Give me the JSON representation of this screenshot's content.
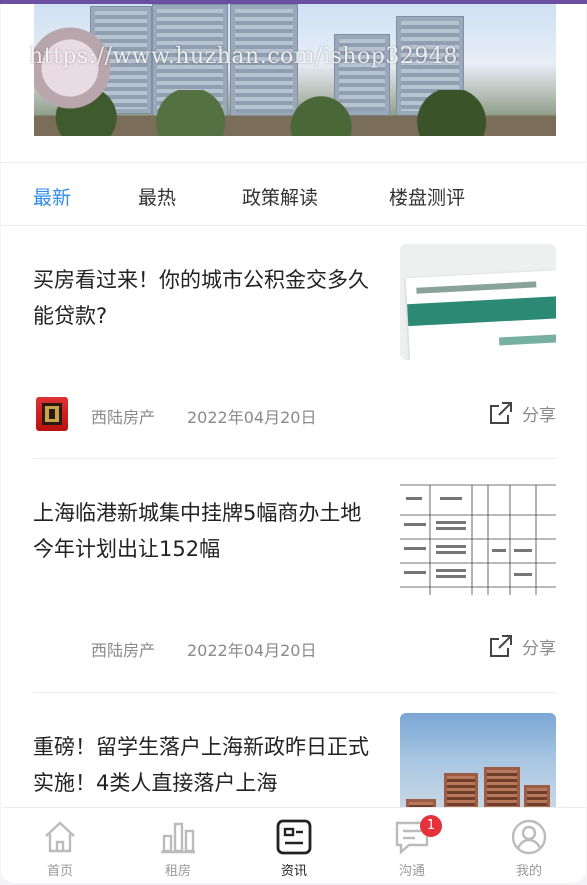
{
  "banner": {
    "watermark": "https://www.huzhan.com/ishop32948"
  },
  "tabs": [
    {
      "label": "最新",
      "active": true
    },
    {
      "label": "最热",
      "active": false
    },
    {
      "label": "政策解读",
      "active": false
    },
    {
      "label": "楼盘测评",
      "active": false
    }
  ],
  "articles": [
    {
      "title": "买房看过来！你的城市公积金交多久能贷款?",
      "source": "西陆房产",
      "date": "2022年04月20日",
      "share_label": "分享"
    },
    {
      "title": "上海临港新城集中挂牌5幅商办土地 今年计划出让152幅",
      "source": "西陆房产",
      "date": "2022年04月20日",
      "share_label": "分享"
    },
    {
      "title": "重磅！留学生落户上海新政昨日正式实施！4类人直接落户上海"
    }
  ],
  "bottom_nav": [
    {
      "label": "首页",
      "icon": "home-icon"
    },
    {
      "label": "租房",
      "icon": "bar-chart-icon"
    },
    {
      "label": "资讯",
      "icon": "news-icon",
      "active": true
    },
    {
      "label": "沟通",
      "icon": "chat-icon",
      "badge": "1"
    },
    {
      "label": "我的",
      "icon": "user-icon"
    }
  ],
  "colors": {
    "accent": "#2f8cf0",
    "badge": "#e5323a",
    "text": "#222222",
    "muted": "#8a8a8a"
  }
}
